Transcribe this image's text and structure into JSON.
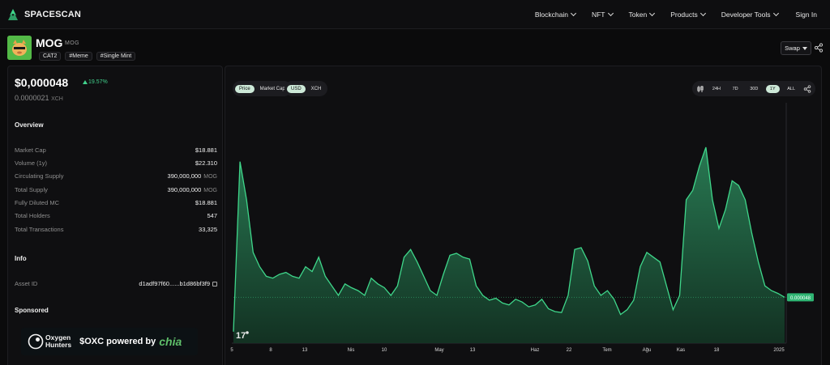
{
  "brand": {
    "name": "SPACESCAN"
  },
  "nav": {
    "items": [
      {
        "label": "Blockchain"
      },
      {
        "label": "NFT"
      },
      {
        "label": "Token"
      },
      {
        "label": "Products"
      },
      {
        "label": "Developer Tools"
      }
    ],
    "sign_in": "Sign In"
  },
  "token": {
    "name": "MOG",
    "symbol": "MOG",
    "tags": [
      "CAT2",
      "#Meme",
      "#Single Mint"
    ],
    "swap_label": "Swap"
  },
  "price": {
    "usd": "$0,000048",
    "change": "19.57%",
    "xch": "0.0000021",
    "xch_unit": "XCH"
  },
  "overview": {
    "title": "Overview",
    "rows": [
      {
        "label": "Market Cap",
        "value": "$18.881",
        "unit": ""
      },
      {
        "label": "Volume (1y)",
        "value": "$22.310",
        "unit": ""
      },
      {
        "label": "Circulating Supply",
        "value": "390,000,000",
        "unit": "MOG"
      },
      {
        "label": "Total Supply",
        "value": "390,000,000",
        "unit": "MOG"
      },
      {
        "label": "Fully Diluted MC",
        "value": "$18.881",
        "unit": ""
      },
      {
        "label": "Total Holders",
        "value": "547",
        "unit": ""
      },
      {
        "label": "Total Transactions",
        "value": "33,325",
        "unit": ""
      }
    ]
  },
  "info": {
    "title": "Info",
    "asset_id_label": "Asset ID",
    "asset_id_value": "d1adf97f60......b1d86bf3f9"
  },
  "sponsored": {
    "title": "Sponsored",
    "brand_line1": "Oxygen",
    "brand_line2": "Hunters",
    "headline": "$OXC powered by",
    "partner": "chia"
  },
  "chart_controls": {
    "metric": [
      {
        "label": "Price",
        "active": true
      },
      {
        "label": "Market Cap",
        "active": false
      }
    ],
    "currency": [
      {
        "label": "USD",
        "active": true
      },
      {
        "label": "XCH",
        "active": false
      }
    ],
    "ranges": [
      {
        "label": "24H",
        "active": false
      },
      {
        "label": "7D",
        "active": false
      },
      {
        "label": "30D",
        "active": false
      },
      {
        "label": "1Y",
        "active": true
      },
      {
        "label": "ALL",
        "active": false
      }
    ]
  },
  "colors": {
    "accent": "#3fd68a",
    "fill": "#1f5a40",
    "positive": "#41d18c",
    "background": "#0f0f11"
  },
  "chart_data": {
    "type": "area",
    "title": "",
    "xlabel": "",
    "ylabel": "",
    "x_ticks": [
      "5",
      "8",
      "13",
      "Nis",
      "10",
      "May",
      "13",
      "Haz",
      "22",
      "Tem",
      "Ağu",
      "Kas",
      "18",
      "2025"
    ],
    "last_value_label": "0.000048",
    "grid": false,
    "series": [
      {
        "values": [
          1.2e-05,
          0.00019,
          0.00015,
          9.5e-05,
          8e-05,
          7e-05,
          6.8e-05,
          7.2e-05,
          7.4e-05,
          7e-05,
          6.8e-05,
          8e-05,
          7.5e-05,
          9e-05,
          7e-05,
          6e-05,
          5e-05,
          6.2e-05,
          5.8e-05,
          5.5e-05,
          5e-05,
          6.8e-05,
          6.2e-05,
          5.8e-05,
          5e-05,
          6e-05,
          9e-05,
          9.8e-05,
          8.5e-05,
          7e-05,
          5.5e-05,
          5e-05,
          7.2e-05,
          9.2e-05,
          9.4e-05,
          9e-05,
          8.8e-05,
          6e-05,
          5e-05,
          4.5e-05,
          4.7e-05,
          4.2e-05,
          4e-05,
          4.6e-05,
          4.3e-05,
          3.8e-05,
          4e-05,
          4.6e-05,
          3.6e-05,
          3.3e-05,
          3.2e-05,
          5e-05,
          9.8e-05,
          0.0001,
          8.6e-05,
          6e-05,
          5e-05,
          5.5e-05,
          4.6e-05,
          3e-05,
          3.5e-05,
          4.5e-05,
          8e-05,
          9.5e-05,
          9e-05,
          8.5e-05,
          6e-05,
          3.5e-05,
          5e-05,
          0.00015,
          0.00016,
          0.000185,
          0.000205,
          0.00015,
          0.00012,
          0.00014,
          0.00017,
          0.000165,
          0.00015,
          0.000115,
          8.5e-05,
          6e-05,
          5.5e-05,
          5.2e-05,
          4.8e-05
        ]
      }
    ]
  }
}
